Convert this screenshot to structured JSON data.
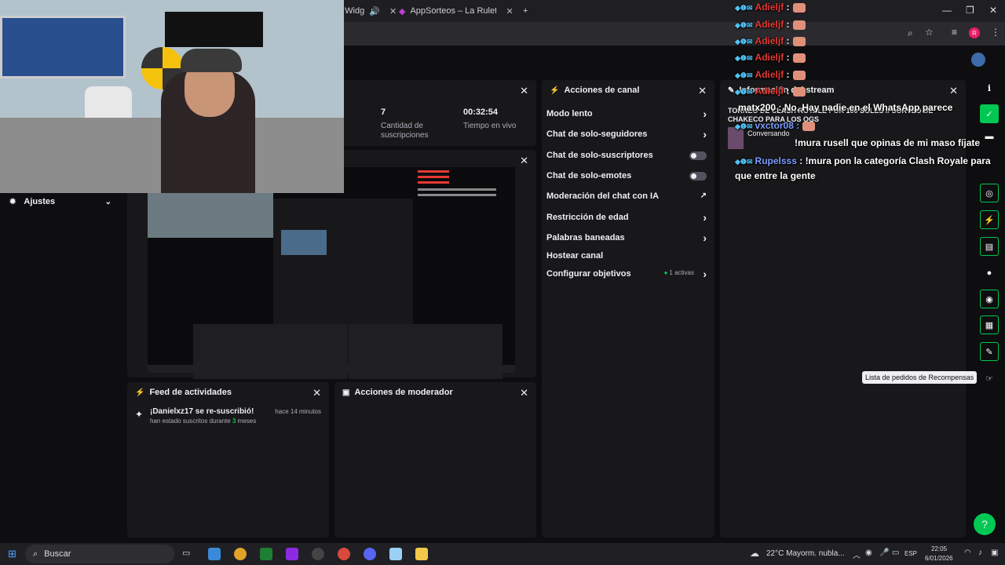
{
  "browser": {
    "tabs": [
      {
        "label": "d Widg"
      },
      {
        "label": "AppSorteos – La Ruleta de la S"
      }
    ],
    "new_tab": "+",
    "profile_initial": "R"
  },
  "stream_info": {
    "stats": [
      {
        "value": "7",
        "label": "Cantidad de suscripciones"
      },
      {
        "value": "00:32:54",
        "label": "Tiempo en vivo"
      }
    ]
  },
  "settings_row": {
    "label": "Ajustes"
  },
  "activity_feed": {
    "title": "Feed de actividades",
    "event_title": "¡Danielxz17 se re-suscribió!",
    "event_time": "hace 14 minutos",
    "event_sub_pre": "han estado suscritos durante",
    "event_sub_num": "3",
    "event_sub_post": "meses"
  },
  "mod_actions": {
    "title": "Acciones de moderador"
  },
  "channel_actions": {
    "title": "Acciones de canal",
    "rows": [
      {
        "label": "Modo lento"
      },
      {
        "label": "Chat de solo-seguidores"
      },
      {
        "label": "Chat de solo-suscriptores"
      },
      {
        "label": "Chat de solo-emotes"
      },
      {
        "label": "Moderación del chat con IA"
      },
      {
        "label": "Restricción de edad"
      },
      {
        "label": "Palabras baneadas"
      },
      {
        "label": "Hostear canal"
      },
      {
        "label": "Configurar objetivos"
      }
    ],
    "goals_active": "1 activas"
  },
  "stream_panel": {
    "title_partial": "Información del stream",
    "stream_title": "TORNEO DE CLASH ROYALE POR 100 SOLES // SORTEO DE CHAKECO PARA LOS OGS",
    "status": "Conversando"
  },
  "chat": {
    "lines": [
      {
        "name": "Adieljf",
        "msg": ":"
      },
      {
        "name": "Adieljf",
        "msg": ":"
      },
      {
        "name": "Adieljf",
        "msg": ":"
      },
      {
        "name": "Adieljf",
        "msg": ":"
      },
      {
        "name": "Adieljf",
        "msg": ":"
      },
      {
        "name": "Adieljf",
        "msg": ":"
      }
    ],
    "matx_line": "matx200 : No, Hay nadie en el WhatsApp parece",
    "vxctor_line": "vxctor08 :",
    "yo_line": "!mura rusell que opinas de mi maso fíjate",
    "rupelsss_name": "Rupelsss",
    "rupelsss_msg": ": !mura pon la categoría Clash Royale para que entre la gente"
  },
  "tooltip": {
    "text": "Lista de pedidos de Recompensas"
  },
  "taskbar": {
    "search_placeholder": "Buscar",
    "weather": "22°C  Mayorm. nubla...",
    "lang": "ESP",
    "time": "22:05",
    "date": "6/01/2026"
  },
  "colors": {
    "accent": "#00c853",
    "panel": "#18181b",
    "bg": "#0e0e10"
  }
}
